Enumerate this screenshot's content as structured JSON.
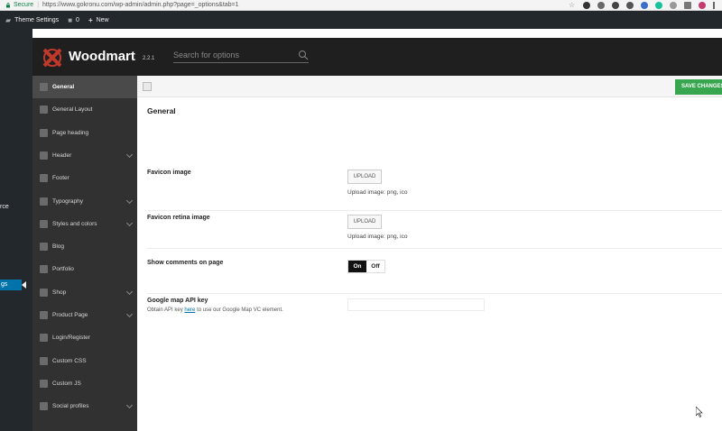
{
  "browser": {
    "secure_label": "Secure",
    "url": "https://www.gokronu.com/wp-admin/admin.php?page=_options&tab=1",
    "extension_icons": [
      "star-icon",
      "circle-icon",
      "recycle-icon",
      "adblock-icon",
      "wordpress-icon",
      "extension-icon",
      "grammarly-icon",
      "s-icon",
      "mail-icon",
      "zz-icon",
      "menu-icon"
    ]
  },
  "admin_bar": {
    "site_label": "Theme Settings",
    "comments_count": "0",
    "new_label": "New"
  },
  "wp_menu": {
    "fragment_1": "rce",
    "fragment_2": "gs"
  },
  "header": {
    "brand": "Woodmart",
    "version": "2.2.1",
    "search_placeholder": "Search for options"
  },
  "sidebar": {
    "items": [
      {
        "label": "General",
        "icon": "home-icon",
        "active": true,
        "has_children": false
      },
      {
        "label": "General Layout",
        "icon": "layout-icon",
        "active": false,
        "has_children": false
      },
      {
        "label": "Page heading",
        "icon": "heading-icon",
        "active": false,
        "has_children": false
      },
      {
        "label": "Header",
        "icon": "wrench-icon",
        "active": false,
        "has_children": true
      },
      {
        "label": "Footer",
        "icon": "footer-icon",
        "active": false,
        "has_children": false
      },
      {
        "label": "Typography",
        "icon": "typography-icon",
        "active": false,
        "has_children": true
      },
      {
        "label": "Styles and colors",
        "icon": "palette-icon",
        "active": false,
        "has_children": true
      },
      {
        "label": "Blog",
        "icon": "pencil-icon",
        "active": false,
        "has_children": false
      },
      {
        "label": "Portfolio",
        "icon": "grid-icon",
        "active": false,
        "has_children": false
      },
      {
        "label": "Shop",
        "icon": "cart-icon",
        "active": false,
        "has_children": true
      },
      {
        "label": "Product Page",
        "icon": "tag-icon",
        "active": false,
        "has_children": true
      },
      {
        "label": "Login/Register",
        "icon": "lock-icon",
        "active": false,
        "has_children": false
      },
      {
        "label": "Custom CSS",
        "icon": "code-icon",
        "active": false,
        "has_children": false
      },
      {
        "label": "Custom JS",
        "icon": "tools-icon",
        "active": false,
        "has_children": false
      },
      {
        "label": "Social profiles",
        "icon": "share-icon",
        "active": false,
        "has_children": true
      }
    ]
  },
  "toolbar": {
    "save_label": "SAVE CHANGES"
  },
  "section": {
    "title": "General",
    "fields": [
      {
        "label": "Favicon image",
        "button": "UPLOAD",
        "help": "Upload image: png, ico"
      },
      {
        "label": "Favicon retina image",
        "button": "UPLOAD",
        "help": "Upload image: png, ico"
      },
      {
        "label": "Show comments on page",
        "on": "On",
        "off": "Off",
        "value": "On"
      },
      {
        "label": "Google map API key",
        "desc_before": "Obtain API key",
        "desc_link": "here",
        "desc_after": "to use our Google Map VC element.",
        "value": ""
      }
    ]
  },
  "colors": {
    "accent_green": "#38a64f",
    "dark_header": "#1f1f1f",
    "sidebar_bg": "#313131",
    "wp_blue": "#0073aa"
  }
}
